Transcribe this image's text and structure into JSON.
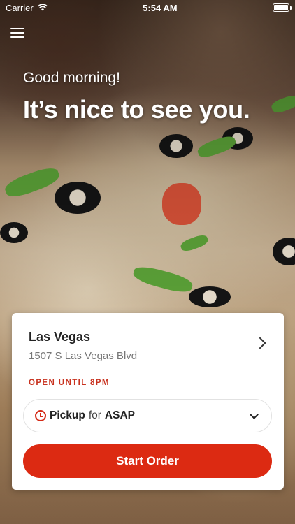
{
  "status_bar": {
    "carrier": "Carrier",
    "time": "5:54 AM",
    "wifi_icon": "wifi-icon",
    "battery_icon": "battery-icon"
  },
  "header": {
    "menu_icon": "hamburger-menu-icon"
  },
  "greeting": {
    "salutation": "Good morning!",
    "headline": "It’s nice to see you."
  },
  "store_card": {
    "store_name": "Las Vegas",
    "address": "1507 S Las Vegas Blvd",
    "open_status": "OPEN UNTIL 8PM",
    "pickup": {
      "mode": "Pickup",
      "connector": "for",
      "time": "ASAP"
    },
    "start_button_label": "Start Order"
  },
  "colors": {
    "accent": "#dc2a12",
    "status_text": "#c8321f",
    "card_bg": "#ffffff"
  }
}
